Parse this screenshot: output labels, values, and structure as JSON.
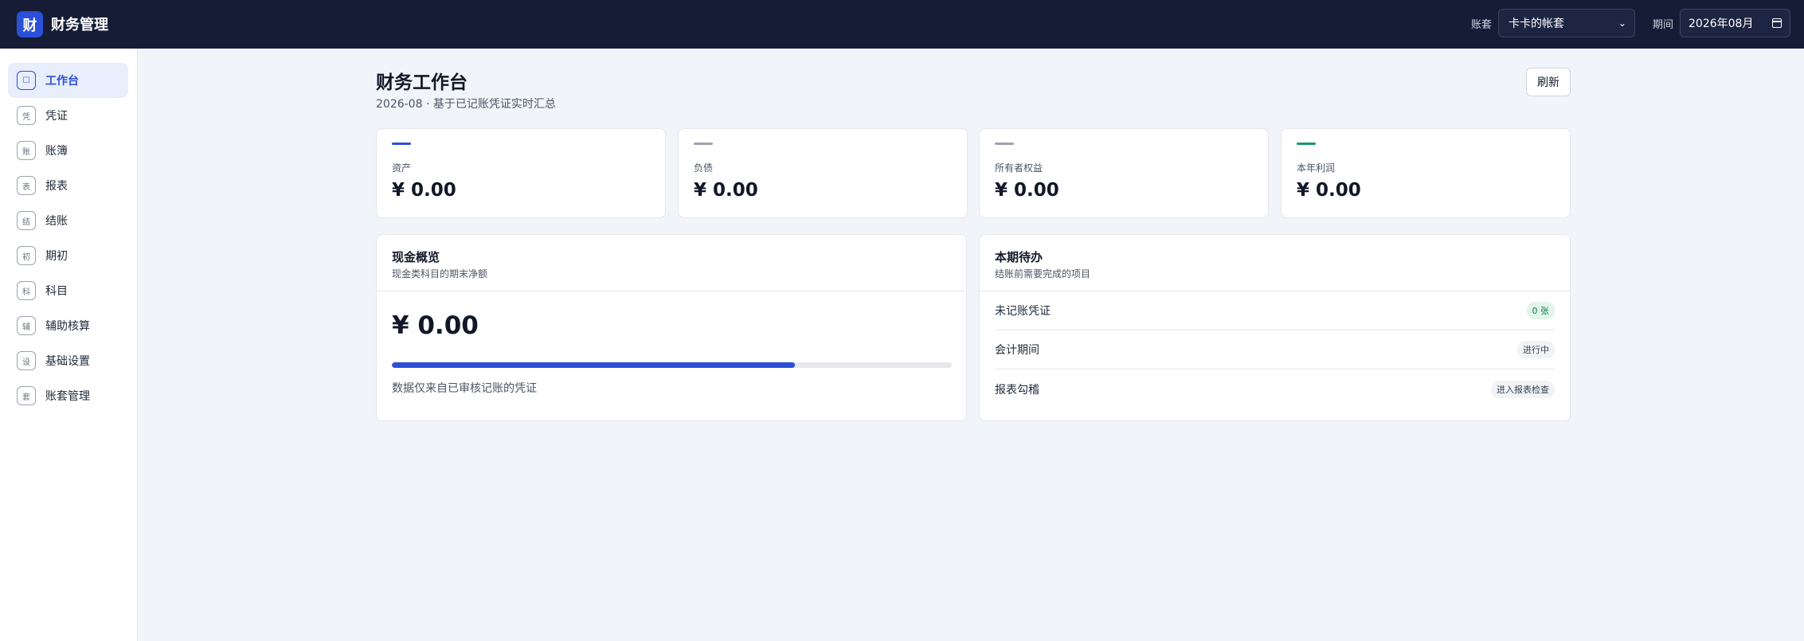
{
  "header": {
    "logo_char": "财",
    "title": "财务管理",
    "account_label": "账套",
    "account_value": "卡卡的帐套",
    "period_label": "期间",
    "period_value": "2026年08月"
  },
  "sidebar": {
    "items": [
      {
        "icon": "☐",
        "label": "工作台",
        "active": true
      },
      {
        "icon": "凭",
        "label": "凭证"
      },
      {
        "icon": "账",
        "label": "账簿"
      },
      {
        "icon": "表",
        "label": "报表"
      },
      {
        "icon": "结",
        "label": "结账"
      },
      {
        "icon": "初",
        "label": "期初"
      },
      {
        "icon": "科",
        "label": "科目"
      },
      {
        "icon": "辅",
        "label": "辅助核算"
      },
      {
        "icon": "设",
        "label": "基础设置"
      },
      {
        "icon": "套",
        "label": "账套管理"
      }
    ]
  },
  "main": {
    "title": "财务工作台",
    "subtitle": "2026-08 · 基于已记账凭证实时汇总",
    "refresh_label": "刷新",
    "stats": [
      {
        "label": "资产",
        "value": "¥ 0.00",
        "color": "#2b4fd6"
      },
      {
        "label": "负债",
        "value": "¥ 0.00",
        "color": "#9ca3af"
      },
      {
        "label": "所有者权益",
        "value": "¥ 0.00",
        "color": "#9ca3af"
      },
      {
        "label": "本年利润",
        "value": "¥ 0.00",
        "color": "#159a65"
      }
    ],
    "cash": {
      "title": "现金概览",
      "subtitle": "现金类科目的期末净额",
      "value": "¥ 0.00",
      "progress": 0.72,
      "note": "数据仅来自已审核记账的凭证"
    },
    "todo": {
      "title": "本期待办",
      "subtitle": "结账前需要完成的项目",
      "rows": [
        {
          "label": "未记账凭证",
          "badge": "0 张"
        },
        {
          "label": "会计期间",
          "badge": "进行中"
        },
        {
          "label": "报表勾稽",
          "badge": "进入报表检查"
        }
      ]
    }
  }
}
